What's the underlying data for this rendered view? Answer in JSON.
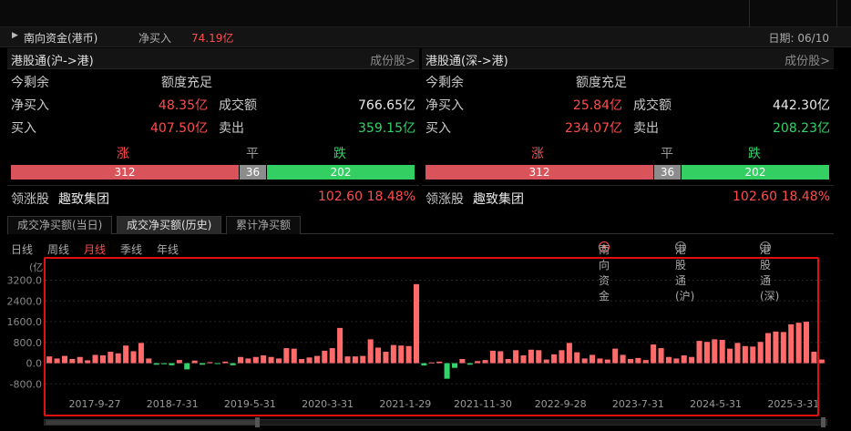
{
  "header": {
    "title": "南向资金(港币)",
    "net_buy_label": "净买入",
    "net_buy_value": "74.19亿",
    "date_label": "日期:",
    "date_value": "06/10"
  },
  "panels": [
    {
      "title": "港股通(沪->港)",
      "link": "成份股>",
      "remain_label": "今剩余",
      "remain_value": "额度充足",
      "net_buy_label": "净买入",
      "net_buy_value": "48.35亿",
      "turnover_label": "成交额",
      "turnover_value": "766.65亿",
      "buy_label": "买入",
      "buy_value": "407.50亿",
      "sell_label": "卖出",
      "sell_value": "359.15亿",
      "up_label": "涨",
      "flat_label": "平",
      "down_label": "跌",
      "up_count": "312",
      "flat_count": "36",
      "down_count": "202",
      "up_n": 312,
      "flat_n": 36,
      "down_n": 202,
      "leader_label": "领涨股",
      "leader_name": "趣致集团",
      "leader_price": "102.60",
      "leader_pct": "18.48%"
    },
    {
      "title": "港股通(深->港)",
      "link": "成份股>",
      "remain_label": "今剩余",
      "remain_value": "额度充足",
      "net_buy_label": "净买入",
      "net_buy_value": "25.84亿",
      "turnover_label": "成交额",
      "turnover_value": "442.30亿",
      "buy_label": "买入",
      "buy_value": "234.07亿",
      "sell_label": "卖出",
      "sell_value": "208.23亿",
      "up_label": "涨",
      "flat_label": "平",
      "down_label": "跌",
      "up_count": "312",
      "flat_count": "36",
      "down_count": "202",
      "up_n": 312,
      "flat_n": 36,
      "down_n": 202,
      "leader_label": "领涨股",
      "leader_name": "趣致集团",
      "leader_price": "102.60",
      "leader_pct": "18.48%"
    }
  ],
  "tabs": [
    "成交净买额(当日)",
    "成交净买额(历史)",
    "累计净买额"
  ],
  "active_tab": 1,
  "periods": [
    "日线",
    "周线",
    "月线",
    "季线",
    "年线"
  ],
  "active_period": 2,
  "radios": [
    "南向资金",
    "港股通(沪)",
    "港股通(深)"
  ],
  "active_radio": 0,
  "colors": {
    "up": "#e35b5b",
    "down": "#33d36b",
    "flat": "#8c8c8c",
    "highlight": "#e01010"
  },
  "chart_data": {
    "type": "bar",
    "ylabel": "(亿",
    "yticks": [
      3200,
      2400,
      1600,
      800,
      0,
      -800
    ],
    "ylim": [
      -1000,
      3500
    ],
    "xtick_labels": [
      "2017-9-27",
      "2018-7-31",
      "2019-5-31",
      "2020-3-31",
      "2021-1-29",
      "2021-11-30",
      "2022-9-28",
      "2023-7-31",
      "2024-5-31",
      "2025-3-31"
    ],
    "values": [
      260,
      180,
      280,
      160,
      240,
      110,
      320,
      300,
      440,
      380,
      680,
      460,
      780,
      180,
      -60,
      -40,
      -80,
      120,
      -240,
      100,
      -60,
      40,
      -30,
      60,
      -80,
      240,
      180,
      240,
      300,
      240,
      180,
      580,
      560,
      160,
      220,
      280,
      480,
      580,
      1360,
      260,
      260,
      280,
      920,
      600,
      440,
      700,
      680,
      660,
      3050,
      -90,
      30,
      60,
      -600,
      -180,
      160,
      -60,
      80,
      120,
      480,
      460,
      160,
      500,
      300,
      520,
      500,
      140,
      340,
      500,
      780,
      420,
      180,
      320,
      180,
      140,
      560,
      320,
      160,
      200,
      120,
      720,
      580,
      240,
      180,
      300,
      240,
      860,
      820,
      920,
      900,
      560,
      780,
      660,
      640,
      820,
      1160,
      1220,
      1200,
      1500,
      1560,
      1600,
      440,
      140
    ]
  }
}
